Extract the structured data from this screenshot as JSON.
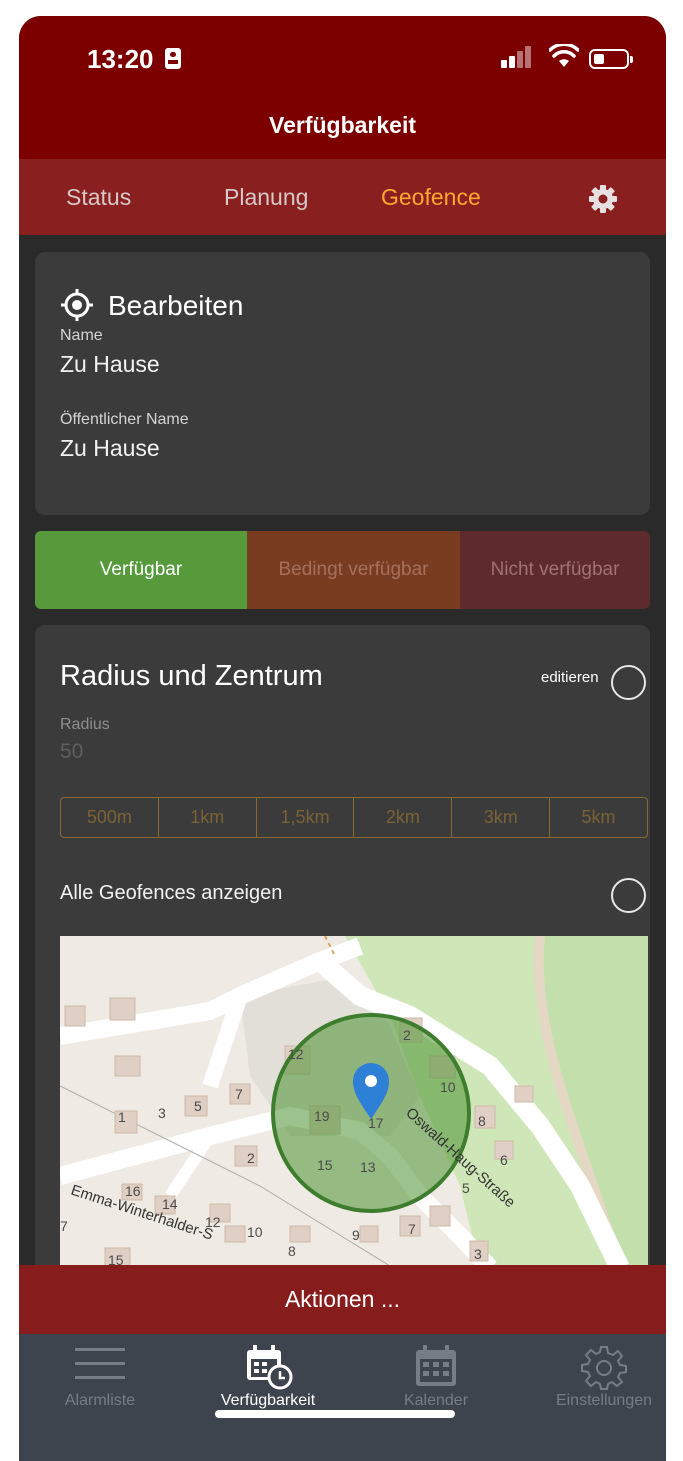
{
  "status_bar": {
    "time": "13:20"
  },
  "header": {
    "title": "Verfügbarkeit"
  },
  "tabs": [
    {
      "label": "Status",
      "active": false
    },
    {
      "label": "Planung",
      "active": false
    },
    {
      "label": "Geofence",
      "active": true
    }
  ],
  "edit_card": {
    "title": "Bearbeiten",
    "name_label": "Name",
    "name_value": "Zu Hause",
    "public_name_label": "Öffentlicher Name",
    "public_name_value": "Zu Hause"
  },
  "availability": {
    "available": "Verfügbar",
    "conditional": "Bedingt verfügbar",
    "unavailable": "Nicht verfügbar",
    "selected": "Verfügbar"
  },
  "radius_card": {
    "title": "Radius und Zentrum",
    "edit_label": "editieren",
    "radius_label": "Radius",
    "radius_value": "50",
    "presets": [
      "500m",
      "1km",
      "1,5km",
      "2km",
      "3km",
      "5km"
    ],
    "show_all_label": "Alle Geofences anzeigen"
  },
  "map": {
    "street_1": "Oswald-Haug-Straße",
    "street_2": "Emma-Winterhalder-S",
    "house_numbers": [
      "12",
      "2",
      "10",
      "19",
      "17",
      "8",
      "15",
      "13",
      "6",
      "5",
      "7",
      "9",
      "3",
      "1",
      "3",
      "5",
      "7",
      "2",
      "16",
      "14",
      "12",
      "10",
      "8",
      "15",
      "7"
    ]
  },
  "actions_bar": {
    "label": "Aktionen ..."
  },
  "bottom_nav": [
    {
      "label": "Alarmliste",
      "icon": "list-icon",
      "active": false
    },
    {
      "label": "Verfügbarkeit",
      "icon": "calendar-clock-icon",
      "active": true
    },
    {
      "label": "Kalender",
      "icon": "calendar-icon",
      "active": false
    },
    {
      "label": "Einstellungen",
      "icon": "gear-icon",
      "active": false
    }
  ],
  "colors": {
    "brand_dark": "#7c0000",
    "brand": "#8a1f20",
    "accent": "#ffa632",
    "available": "#569a3c",
    "geofence": "#3e7d2e"
  }
}
